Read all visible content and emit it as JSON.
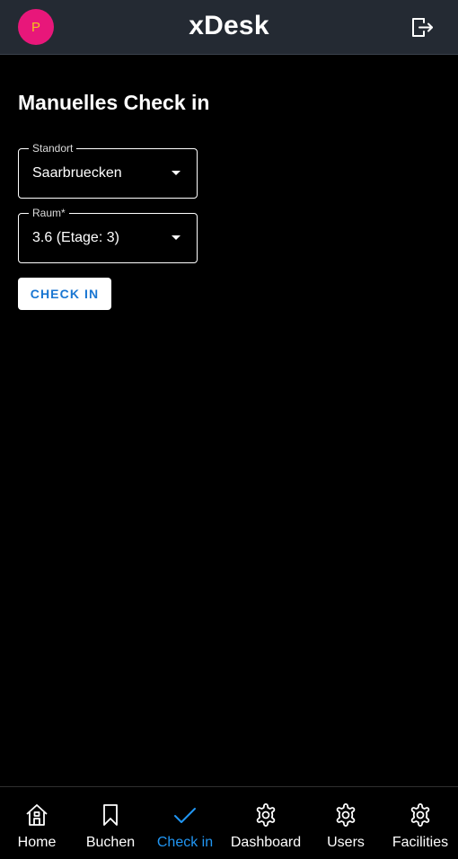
{
  "header": {
    "avatar_initial": "P",
    "app_title": "xDesk"
  },
  "main": {
    "title": "Manuelles Check in",
    "location_field": {
      "label": "Standort",
      "value": "Saarbruecken"
    },
    "room_field": {
      "label": "Raum*",
      "value": "3.6 (Etage: 3)"
    },
    "checkin_button": "CHECK IN"
  },
  "nav": {
    "items": [
      {
        "label": "Home",
        "icon": "home-icon"
      },
      {
        "label": "Buchen",
        "icon": "bookmark-icon"
      },
      {
        "label": "Check in",
        "icon": "check-icon",
        "active": true
      },
      {
        "label": "Dashboard",
        "icon": "gear-icon"
      },
      {
        "label": "Users",
        "icon": "gear-icon"
      },
      {
        "label": "Facilities",
        "icon": "gear-icon"
      }
    ]
  },
  "colors": {
    "header_bg": "#242a33",
    "avatar_bg": "#e8177a",
    "avatar_text": "#f5c21b",
    "accent": "#2196f3",
    "button_text": "#1976d2"
  }
}
